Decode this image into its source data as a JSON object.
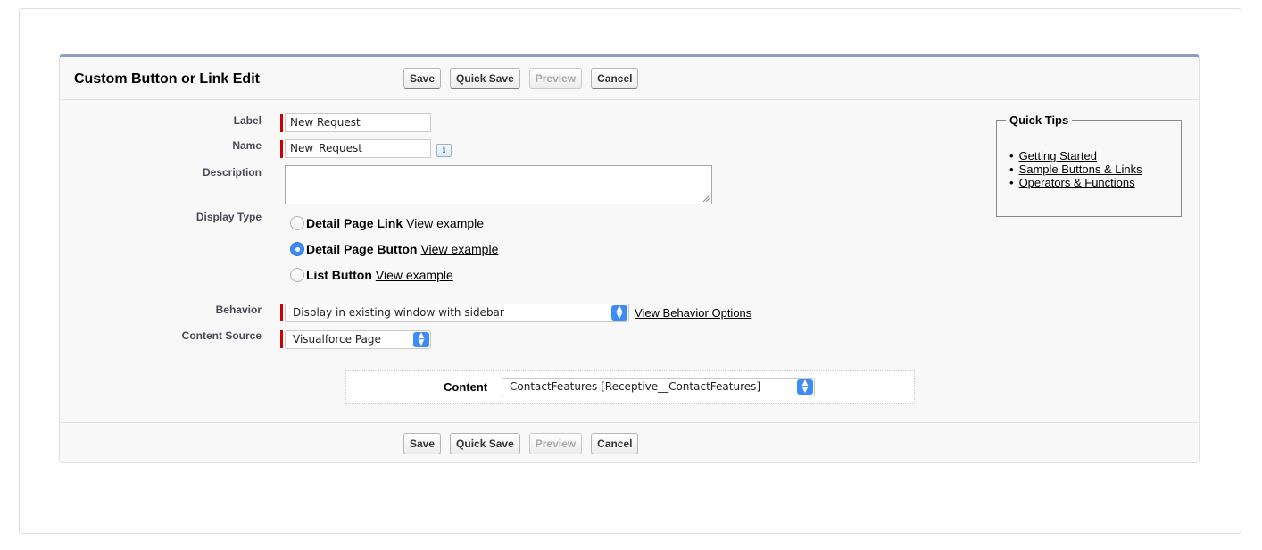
{
  "panel": {
    "title": "Custom Button or Link Edit"
  },
  "buttons": {
    "save": "Save",
    "quick_save": "Quick Save",
    "preview": "Preview",
    "cancel": "Cancel"
  },
  "form": {
    "label": {
      "label": "Label",
      "value": "New Request"
    },
    "name": {
      "label": "Name",
      "value": "New_Request",
      "info_icon": "i"
    },
    "description": {
      "label": "Description",
      "value": ""
    },
    "display_type": {
      "label": "Display Type",
      "options": [
        {
          "label": "Detail Page Link",
          "link": "View example",
          "checked": false
        },
        {
          "label": "Detail Page Button",
          "link": "View example",
          "checked": true
        },
        {
          "label": "List Button",
          "link": "View example",
          "checked": false
        }
      ]
    },
    "behavior": {
      "label": "Behavior",
      "selected": "Display in existing window with sidebar",
      "link": "View Behavior Options"
    },
    "content_source": {
      "label": "Content Source",
      "selected": "Visualforce Page"
    },
    "content": {
      "label": "Content",
      "selected": "ContactFeatures [Receptive__ContactFeatures]"
    }
  },
  "quick_tips": {
    "title": "Quick Tips",
    "links": [
      "Getting Started",
      "Sample Buttons & Links",
      "Operators & Functions"
    ]
  },
  "colors": {
    "required": "#cc0000",
    "panel_accent": "#8a9ebe",
    "select_accent": "#3d8bf5"
  }
}
